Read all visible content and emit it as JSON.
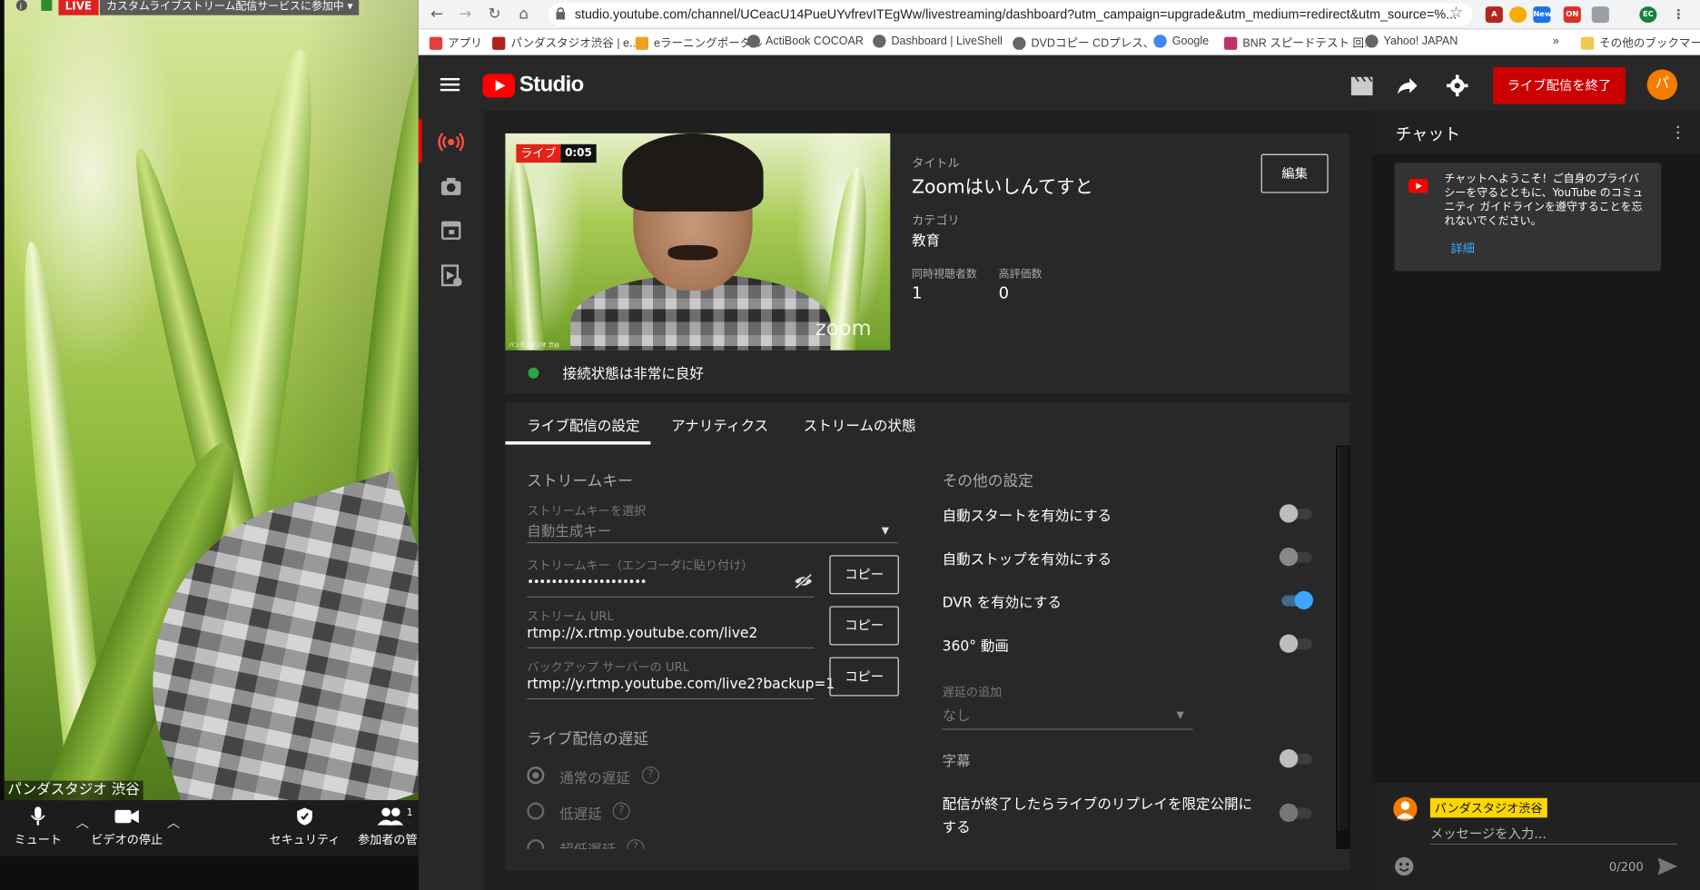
{
  "zoom": {
    "live_badge": "LIVE",
    "title": "カスタムライブストリーム配信サービスに参加中",
    "participant_name": "パンダスタジオ 渋谷",
    "toolbar": {
      "mute": "ミュート",
      "stop_video": "ビデオの停止",
      "security": "セキュリティ",
      "participants": "参加者の管",
      "participants_count": "1"
    }
  },
  "browser": {
    "url": "studio.youtube.com/channel/UCeacU14PueUYvfrevITEgWw/livestreaming/dashboard?utm_campaign=upgrade&utm_medium=redirect&utm_source=%...",
    "extensions": [
      "New",
      "ON"
    ],
    "profile_initials": "EC",
    "bookmarks": [
      {
        "label": "アプリ",
        "color": "#e04040"
      },
      {
        "label": "パンダスタジオ渋谷 | e...",
        "color": "#b02020"
      },
      {
        "label": "eラーニングポータル",
        "color": "#f0a020"
      },
      {
        "label": "ActiBook COCOAR",
        "color": "#666666"
      },
      {
        "label": "Dashboard | LiveShell",
        "color": "#666666"
      },
      {
        "label": "DVDコピー CDプレス、...",
        "color": "#666666"
      },
      {
        "label": "Google",
        "color": "#4285f4"
      },
      {
        "label": "BNR スピードテスト 回...",
        "color": "#c0306a"
      },
      {
        "label": "Yahoo! JAPAN",
        "color": "#666666"
      }
    ],
    "bookmarks_overflow": "»",
    "other_bookmarks": "その他のブックマーク"
  },
  "studio": {
    "logo_text": "Studio",
    "end_stream_button": "ライブ配信を終了",
    "avatar_initial": "パ",
    "live_badge": "ライブ",
    "live_time": "0:05",
    "thumb_watermark": "zoom",
    "thumb_name": "パンダスタジオ 渋谷",
    "title_label": "タイトル",
    "title_value": "Zoomはいしんてすと",
    "edit_button": "編集",
    "category_label": "カテゴリ",
    "category_value": "教育",
    "viewers_label": "同時視聴者数",
    "viewers_value": "1",
    "likes_label": "高評価数",
    "likes_value": "0",
    "connection_status": "接続状態は非常に良好",
    "tabs": [
      "ライブ配信の設定",
      "アナリティクス",
      "ストリームの状態"
    ],
    "stream_key_section": "ストリームキー",
    "select_key_label": "ストリームキーを選択",
    "select_key_value": "自動生成キー",
    "key_label": "ストリームキー（エンコーダに貼り付け）",
    "key_value": "••••••••••••••••••••",
    "url_label": "ストリーム URL",
    "url_value": "rtmp://x.rtmp.youtube.com/live2",
    "backup_label": "バックアップ サーバーの URL",
    "backup_value": "rtmp://y.rtmp.youtube.com/live2?backup=1",
    "copy": "コピー",
    "latency_section": "ライブ配信の遅延",
    "latency_options": [
      "通常の遅延",
      "低遅延",
      "超低遅延"
    ],
    "other_section": "その他の設定",
    "toggles": [
      {
        "label": "自動スタートを有効にする",
        "on": false
      },
      {
        "label": "自動ストップを有効にする",
        "on": false
      },
      {
        "label": "DVR を有効にする",
        "on": true
      },
      {
        "label": "360° 動画",
        "on": false
      }
    ],
    "delay_label": "遅延の追加",
    "delay_value": "なし",
    "captions_label": "字幕",
    "captions_on": false,
    "replay_label_1": "配信が終了したらライブのリプレイを限定公開に",
    "replay_label_2": "する",
    "replay_on": false,
    "accent_color": "#ff0000",
    "toggle_on_color": "#3ea6ff"
  },
  "chat": {
    "title": "チャット",
    "welcome": [
      "チャットへようこそ！ご自身のプライバ",
      "シーを守るとともに、YouTube のコミュ",
      "ニティ ガイドラインを遵守することを忘",
      "れないでください。"
    ],
    "details_link": "詳細",
    "user_name": "パンダスタジオ渋谷",
    "input_placeholder": "メッセージを入力...",
    "counter": "0/200"
  }
}
